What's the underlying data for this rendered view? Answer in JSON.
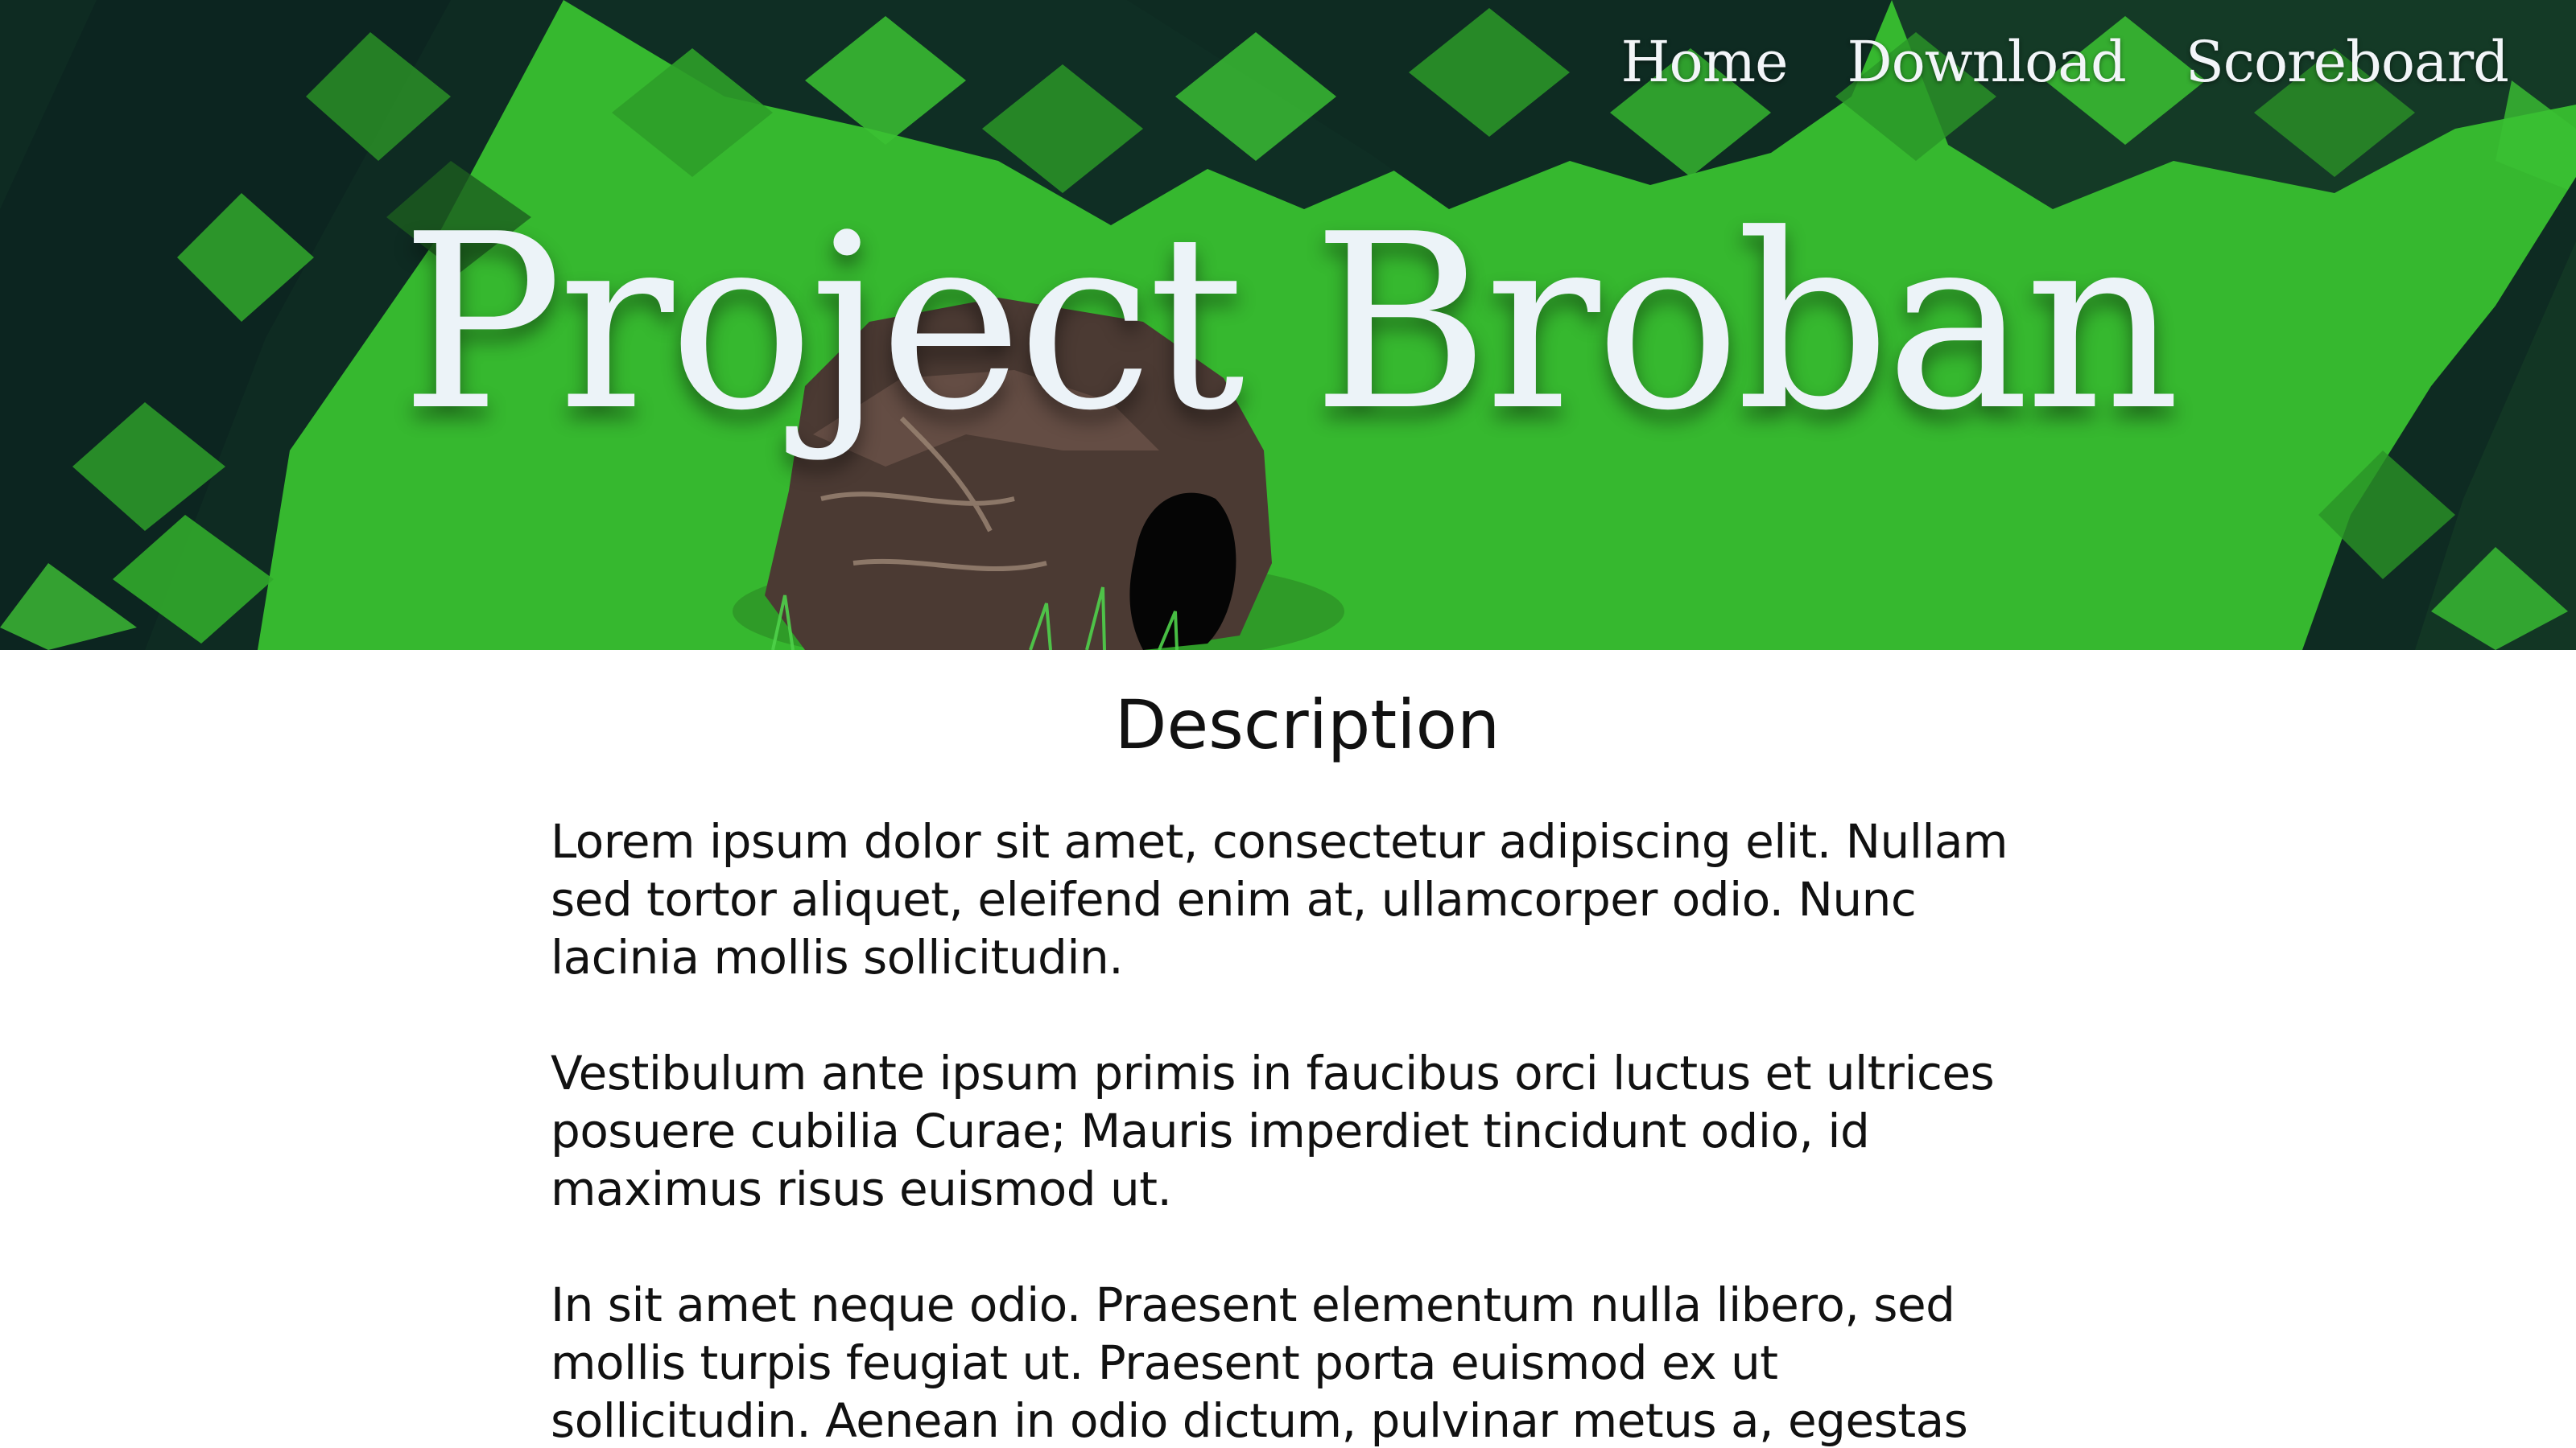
{
  "nav": {
    "items": [
      {
        "label": "Home"
      },
      {
        "label": "Download"
      },
      {
        "label": "Scoreboard"
      }
    ]
  },
  "hero": {
    "title": "Project Broban",
    "background_color": "#36b82f",
    "dark_shade_color": "#0e2b22"
  },
  "content": {
    "heading": "Description",
    "paragraphs": [
      "Lorem ipsum dolor sit amet, consectetur adipiscing elit. Nullam sed tortor aliquet, eleifend enim at, ullamcorper odio. Nunc lacinia mollis sollicitudin.",
      "Vestibulum ante ipsum primis in faucibus orci luctus et ultrices posuere cubilia Curae; Mauris imperdiet tincidunt odio, id maximus risus euismod ut.",
      "In sit amet neque odio. Praesent elementum nulla libero, sed mollis turpis feugiat ut. Praesent porta euismod ex ut sollicitudin. Aenean in odio dictum, pulvinar metus a, egestas massa. Quisque"
    ]
  }
}
